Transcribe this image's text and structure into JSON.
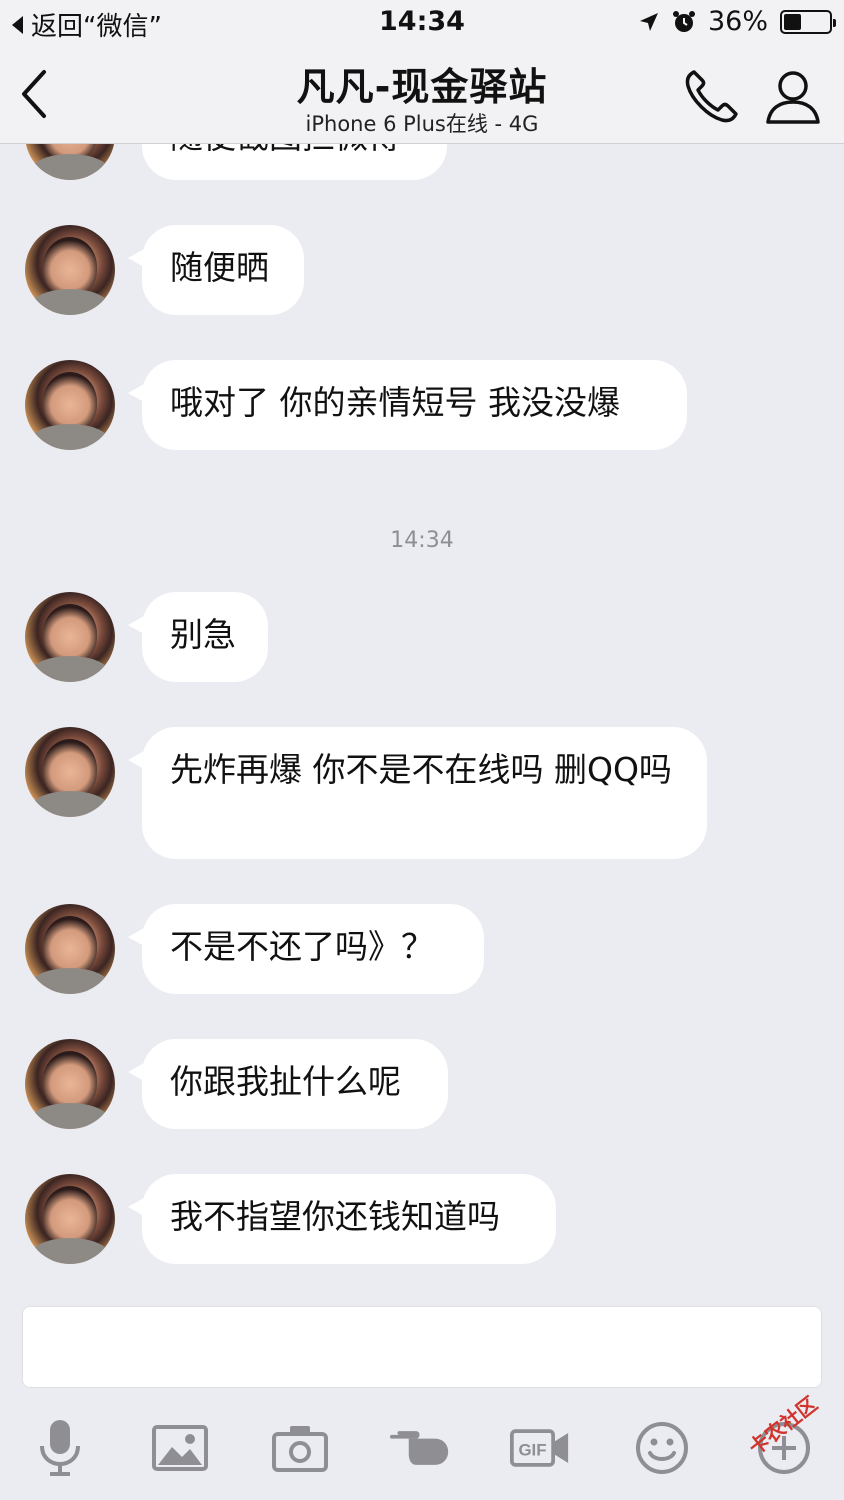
{
  "status_bar": {
    "back_label": "返回“微信”",
    "time": "14:34",
    "battery_percent": "36%"
  },
  "nav": {
    "title": "凡凡-现金驿站",
    "subtitle": "iPhone 6 Plus在线 - 4G"
  },
  "messages": [
    {
      "text": "随便截图拦微博"
    },
    {
      "text": "随便晒"
    },
    {
      "text": "哦对了 你的亲情短号 我没没爆"
    },
    {
      "text": "别急"
    },
    {
      "text": "先炸再爆 你不是不在线吗 删QQ吗"
    },
    {
      "text": "不是不还了吗》？"
    },
    {
      "text": "你跟我扯什么呢"
    },
    {
      "text": "我不指望你还钱知道吗"
    }
  ],
  "timestamp": "14:34",
  "toolbar": {
    "icons": [
      "microphone-icon",
      "image-icon",
      "camera-icon",
      "poke-hand-icon",
      "gif-icon",
      "emoji-icon",
      "plus-icon"
    ]
  },
  "watermark": "卡农社区",
  "colors": {
    "background": "#ebecf1",
    "bubble": "#ffffff",
    "icon_gray": "#8e8e93",
    "watermark_red": "#d0342c"
  }
}
